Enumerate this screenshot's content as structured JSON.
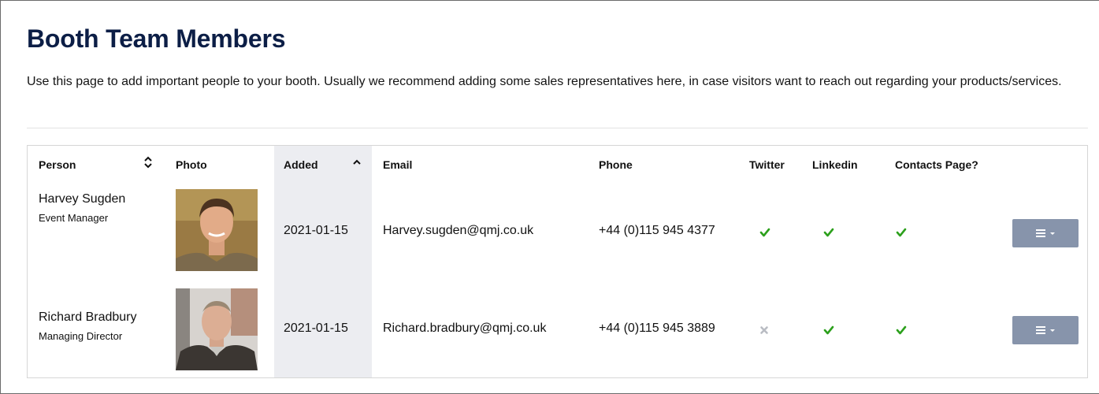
{
  "page": {
    "title": "Booth Team Members",
    "description": "Use this page to add important people to your booth. Usually we recommend adding some sales representatives here, in case visitors want to reach out regarding your products/services."
  },
  "table": {
    "headers": {
      "person": "Person",
      "photo": "Photo",
      "added": "Added",
      "email": "Email",
      "phone": "Phone",
      "twitter": "Twitter",
      "linkedin": "Linkedin",
      "contacts_page": "Contacts Page?"
    },
    "sort": {
      "person": "unsorted",
      "added": "ascending"
    },
    "rows": [
      {
        "name": "Harvey Sugden",
        "role": "Event Manager",
        "added": "2021-01-15",
        "email": "Harvey.sugden@qmj.co.uk",
        "phone": "+44 (0)115 945 4377",
        "twitter": true,
        "linkedin": true,
        "contacts_page": true
      },
      {
        "name": "Richard Bradbury",
        "role": "Managing Director",
        "added": "2021-01-15",
        "email": "Richard.bradbury@qmj.co.uk",
        "phone": "+44 (0)115 945 3889",
        "twitter": false,
        "linkedin": true,
        "contacts_page": true
      }
    ]
  },
  "icons": {
    "check": "check-icon",
    "cross": "cross-icon",
    "sort": "sort-icon",
    "sort_asc": "sort-ascending-icon",
    "menu": "menu-icon",
    "caret": "caret-down-icon"
  },
  "colors": {
    "title": "#0c1e46",
    "check": "#2ca01c",
    "cross": "#b9bcc3",
    "action_button": "#8794ab",
    "sorted_column": "#ecedf1"
  }
}
